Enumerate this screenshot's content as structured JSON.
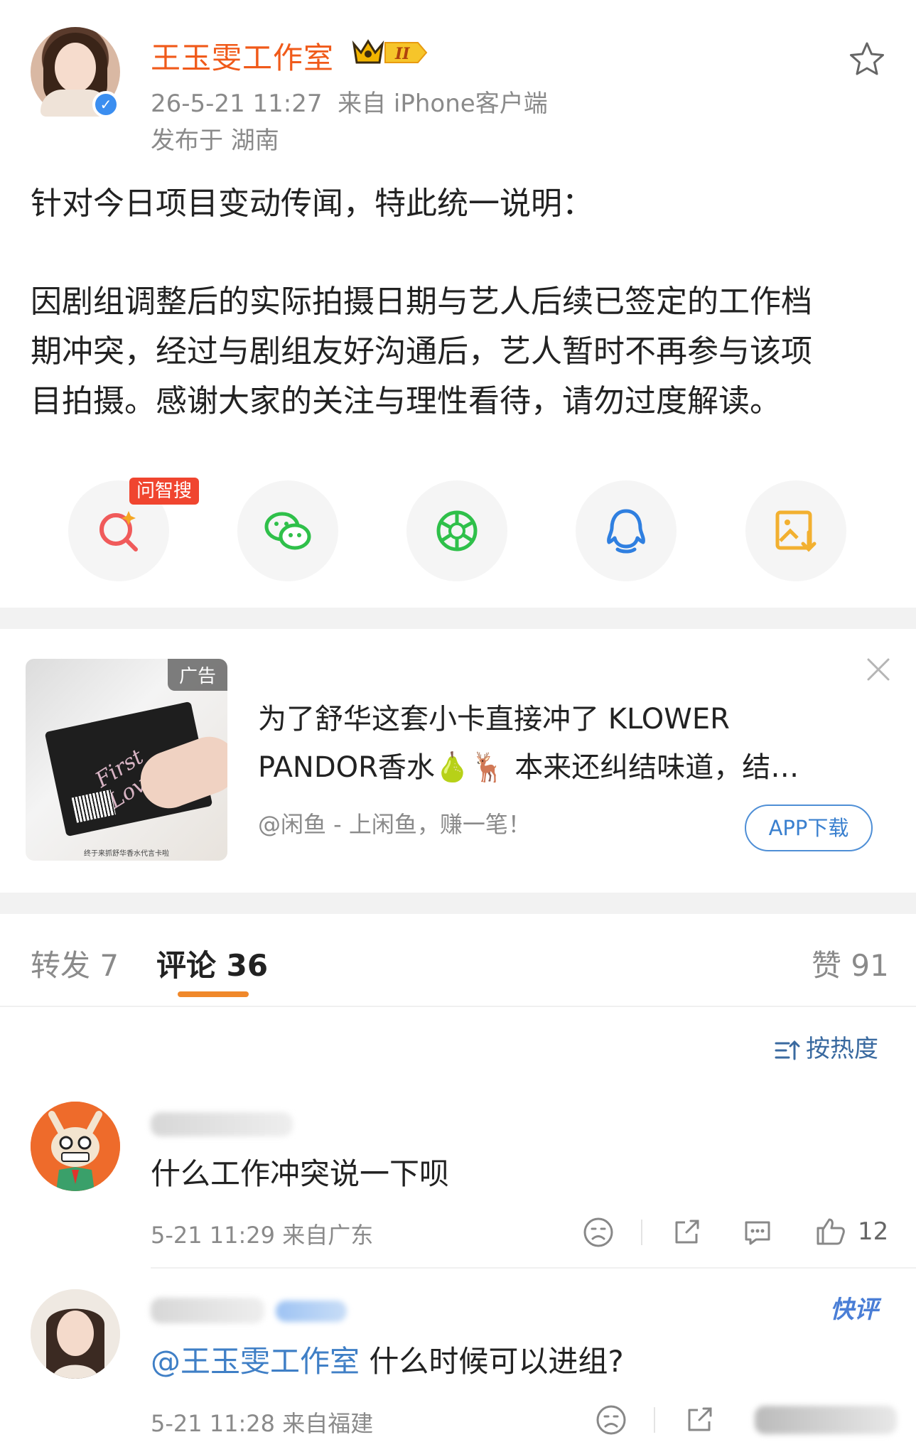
{
  "header": {
    "user_name": "王玉雯工作室",
    "level_badge": "II",
    "timestamp": "26-5-21 11:27",
    "source": "来自 iPhone客户端",
    "location": "发布于 湖南"
  },
  "post": {
    "paragraph1": "针对今日项目变动传闻，特此统一说明：",
    "paragraph2_line1": "因剧组调整后的实际拍摄日期与艺人后续已签定的工作档",
    "paragraph2_line2": "期冲突，经过与剧组友好沟通后，艺人暂时不再参与该项",
    "paragraph2_line3": "目拍摄。感谢大家的关注与理性看待，请勿过度解读。"
  },
  "share": {
    "ai_badge": "问智搜",
    "buttons": [
      {
        "icon": "ai-search-icon",
        "color": "#f05a5a"
      },
      {
        "icon": "wechat-icon",
        "color": "#2fc04a"
      },
      {
        "icon": "moments-icon",
        "color": "#2fc04a"
      },
      {
        "icon": "qq-icon",
        "color": "#2f7fe0"
      },
      {
        "icon": "save-image-icon",
        "color": "#f2b030"
      }
    ]
  },
  "ad": {
    "tag": "广告",
    "card_text": "First Love",
    "image_caption": "终于来抓舒华香水代言卡啦",
    "title_line1": "为了舒华这套小卡直接冲了 KLOWER",
    "title_line2": "PANDOR香水🍐🦌 本来还纠结味道，结…",
    "source": "@闲鱼 - 上闲鱼，赚一笔！",
    "button": "APP下载"
  },
  "tabs": {
    "repost": "转发 7",
    "comment": "评论 36",
    "like": "赞 91"
  },
  "sort": {
    "label": "按热度"
  },
  "comments": [
    {
      "text": "什么工作冲突说一下呗",
      "meta": "5-21 11:29 来自广东",
      "likes": "12"
    },
    {
      "mention": "@王玉雯工作室",
      "text": " 什么时候可以进组?",
      "meta": "5-21 11:28 来自福建",
      "badge": "快评"
    }
  ],
  "colors": {
    "accent_orange": "#f05a1a",
    "link_blue": "#3f7fc6",
    "meta_gray": "#8a8a8a"
  }
}
